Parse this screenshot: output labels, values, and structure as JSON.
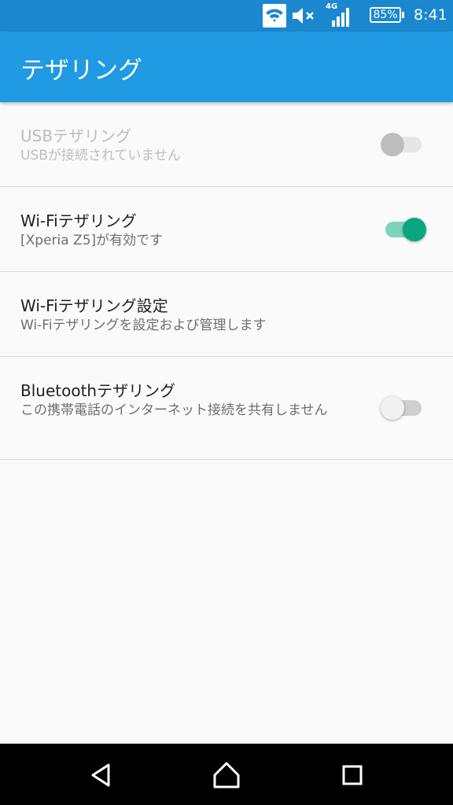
{
  "status_bar": {
    "network_type": "4G",
    "battery": "85%",
    "time": "8:41",
    "icons": [
      "wifi-icon",
      "mute-icon",
      "signal-icon",
      "battery-icon"
    ]
  },
  "app_bar": {
    "title": "テザリング"
  },
  "settings": [
    {
      "title": "USBテザリング",
      "summary": "USBが接続されていません",
      "switch": "off",
      "enabled": false
    },
    {
      "title": "Wi-Fiテザリング",
      "summary": "[Xperia Z5]が有効です",
      "switch": "on",
      "enabled": true
    },
    {
      "title": "Wi-Fiテザリング設定",
      "summary": "Wi-Fiテザリングを設定および管理します",
      "enabled": true
    },
    {
      "title": "Bluetoothテザリング",
      "summary": "この携帯電話のインターネット接続を共有しません",
      "switch": "off",
      "enabled": true
    }
  ],
  "nav_bar": {
    "icons": [
      "back-icon",
      "home-icon",
      "recents-icon"
    ]
  },
  "colors": {
    "app_bar": "#1f9ae3",
    "status_bar": "#1a87cf",
    "switch_on": "#0aa680"
  }
}
